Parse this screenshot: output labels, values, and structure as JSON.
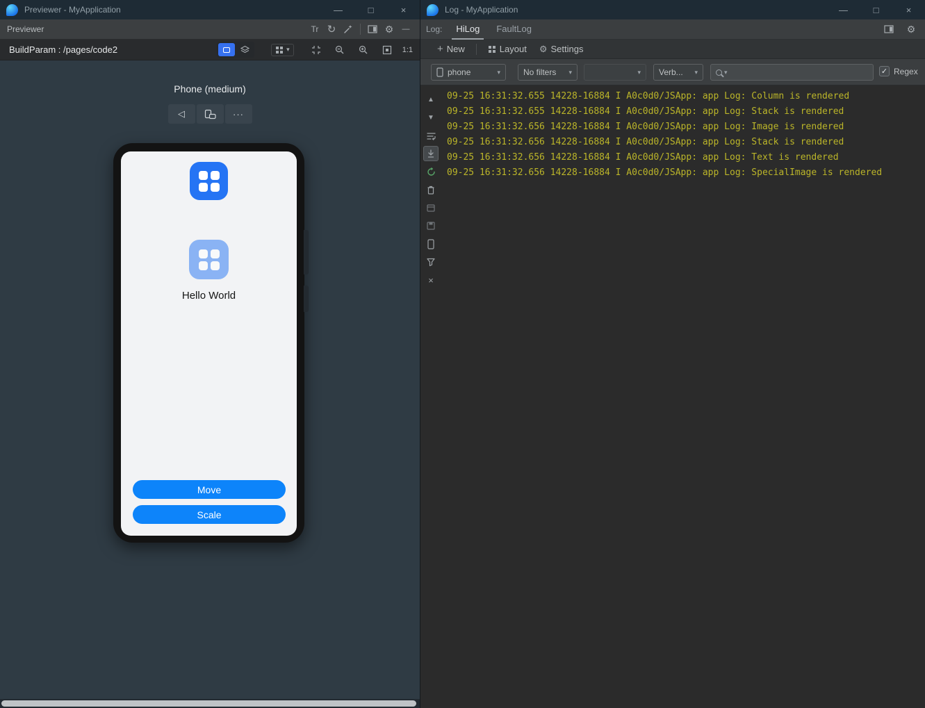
{
  "colors": {
    "titlebar_bg": "#1e2b35",
    "preview_bg": "#2f3b44",
    "accent_blue": "#0d84fa",
    "app_icon_blue": "#2574f4",
    "log_text": "#bbb529"
  },
  "icons": {
    "minimize": "—",
    "maximize": "□",
    "close": "×",
    "gear": "⚙",
    "refresh": "↻",
    "text_tool": "Tr",
    "caret": "▾",
    "back": "◁",
    "more": "···",
    "plus": "+",
    "up": "▲",
    "down": "▼",
    "check": "✓",
    "close_small": "×"
  },
  "previewer": {
    "title": "Previewer - MyApplication",
    "toolbar_label": "Previewer",
    "build_param": "BuildParam : /pages/code2",
    "device_label": "Phone (medium)",
    "zoom_ratio": "1:1",
    "screen": {
      "hello_text": "Hello World",
      "move_label": "Move",
      "scale_label": "Scale"
    }
  },
  "log": {
    "title": "Log - MyApplication",
    "panel_label": "Log:",
    "tabs": [
      {
        "label": "HiLog"
      },
      {
        "label": "FaultLog"
      }
    ],
    "toolbar": {
      "new_label": "New",
      "layout_label": "Layout",
      "settings_label": "Settings"
    },
    "filters": {
      "device": "phone",
      "filter": "No filters",
      "level": "Verb...",
      "search_value": "",
      "search_placeholder": "",
      "regex_label": "Regex",
      "regex_checked": true
    },
    "lines": [
      "09-25 16:31:32.655 14228-16884 I A0c0d0/JSApp: app Log: Column is rendered",
      "09-25 16:31:32.655 14228-16884 I A0c0d0/JSApp: app Log: Stack is rendered",
      "09-25 16:31:32.656 14228-16884 I A0c0d0/JSApp: app Log: Image is rendered",
      "09-25 16:31:32.656 14228-16884 I A0c0d0/JSApp: app Log: Stack is rendered",
      "09-25 16:31:32.656 14228-16884 I A0c0d0/JSApp: app Log: Text is rendered",
      "09-25 16:31:32.656 14228-16884 I A0c0d0/JSApp: app Log: SpecialImage is rendered"
    ]
  }
}
